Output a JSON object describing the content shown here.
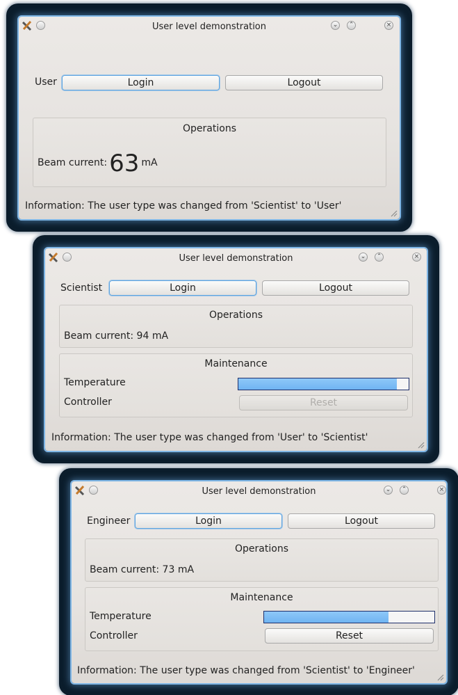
{
  "windows": [
    {
      "title": "User level demonstration",
      "user_type": "User",
      "login_label": "Login",
      "logout_label": "Logout",
      "operations_title": "Operations",
      "beam_prefix": "Beam current:",
      "beam_value": "63",
      "beam_unit": "mA",
      "info": "Information: The user type was changed from 'Scientist' to 'User'"
    },
    {
      "title": "User level demonstration",
      "user_type": "Scientist",
      "login_label": "Login",
      "logout_label": "Logout",
      "operations_title": "Operations",
      "beam_text": "Beam current: 94 mA",
      "maintenance_title": "Maintenance",
      "temperature_label": "Temperature",
      "temperature_level": 0.93,
      "controller_label": "Controller",
      "reset_label": "Reset",
      "reset_enabled": false,
      "info": "Information: The user type was changed from 'User' to 'Scientist'"
    },
    {
      "title": "User level demonstration",
      "user_type": "Engineer",
      "login_label": "Login",
      "logout_label": "Logout",
      "operations_title": "Operations",
      "beam_text": "Beam current: 73 mA",
      "maintenance_title": "Maintenance",
      "temperature_label": "Temperature",
      "temperature_level": 0.73,
      "controller_label": "Controller",
      "reset_label": "Reset",
      "reset_enabled": true,
      "info": "Information: The user type was changed from 'Scientist' to 'Engineer'"
    }
  ],
  "icons": {
    "app": "app-tools-icon",
    "menu": "window-menu-icon",
    "minimize": "minimize-icon",
    "maximize": "maximize-icon",
    "close": "close-icon",
    "resize": "resize-grip-icon"
  }
}
